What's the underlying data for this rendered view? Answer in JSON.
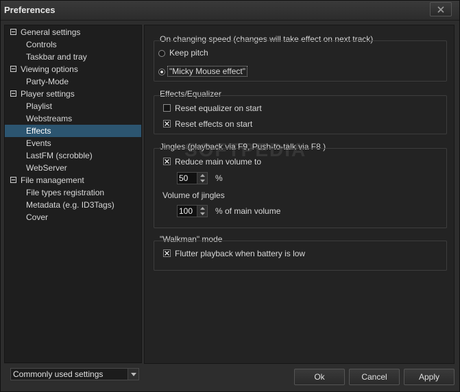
{
  "window": {
    "title": "Preferences"
  },
  "tree": {
    "items": [
      {
        "label": "General settings",
        "level": 0
      },
      {
        "label": "Controls",
        "level": 1
      },
      {
        "label": "Taskbar and tray",
        "level": 1
      },
      {
        "label": "Viewing options",
        "level": 0
      },
      {
        "label": "Party-Mode",
        "level": 1
      },
      {
        "label": "Player settings",
        "level": 0
      },
      {
        "label": "Playlist",
        "level": 1
      },
      {
        "label": "Webstreams",
        "level": 1
      },
      {
        "label": "Effects",
        "level": 1,
        "selected": true
      },
      {
        "label": "Events",
        "level": 1
      },
      {
        "label": "LastFM (scrobble)",
        "level": 1
      },
      {
        "label": "WebServer",
        "level": 1
      },
      {
        "label": "File management",
        "level": 0
      },
      {
        "label": "File types registration",
        "level": 1
      },
      {
        "label": "Metadata (e.g. ID3Tags)",
        "level": 1
      },
      {
        "label": "Cover",
        "level": 1
      }
    ]
  },
  "speed": {
    "title": "On changing speed (changes will take effect on next track)",
    "keep_pitch": "Keep pitch",
    "micky": "\"Micky Mouse effect\"",
    "selected": "micky"
  },
  "equalizer": {
    "title": "Effects/Equalizer",
    "reset_eq": "Reset equalizer on start",
    "reset_eq_checked": false,
    "reset_effects": "Reset effects on start",
    "reset_effects_checked": true
  },
  "jingles": {
    "title": "Jingles (playback via F9, Push-to-talk via F8 )",
    "reduce_label": "Reduce main volume to",
    "reduce_checked": true,
    "reduce_value": "50",
    "reduce_unit": "%",
    "volume_title": "Volume of jingles",
    "volume_value": "100",
    "volume_unit": "% of main volume"
  },
  "walkman": {
    "title": "\"Walkman\" mode",
    "flutter": "Flutter playback when battery is low",
    "flutter_checked": true
  },
  "watermark": "SOFTPEDIA",
  "footer": {
    "dropdown_value": "Commonly used settings",
    "ok": "Ok",
    "cancel": "Cancel",
    "apply": "Apply"
  },
  "colors": {
    "selection": "#2c5570",
    "panel": "#232323",
    "window": "#2d2d2d"
  }
}
